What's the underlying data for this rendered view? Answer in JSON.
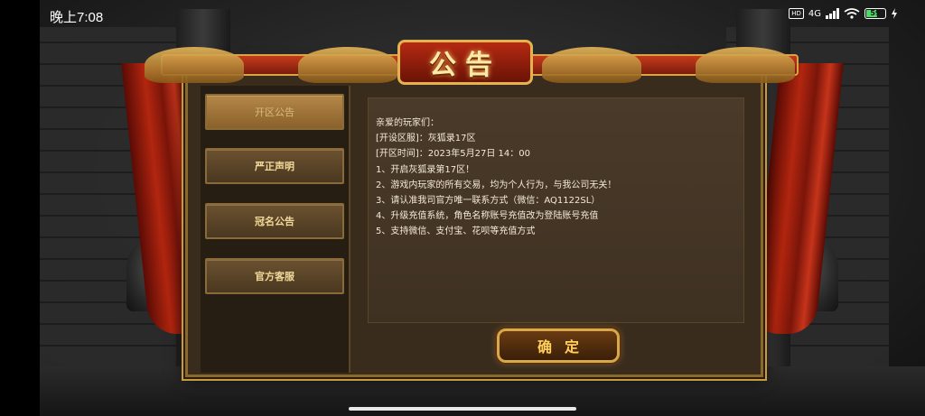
{
  "status_bar": {
    "time": "晚上7:08",
    "hd": "HD",
    "network": "4G",
    "battery": "59"
  },
  "dialog": {
    "title": "公告",
    "menu": [
      {
        "label": "开区公告",
        "active": true
      },
      {
        "label": "严正声明",
        "active": false
      },
      {
        "label": "冠名公告",
        "active": false
      },
      {
        "label": "官方客服",
        "active": false
      }
    ],
    "content_lines": [
      "亲爱的玩家们：",
      "[开设区服]：灰狐录17区",
      "[开区时间]：2023年5月27日 14：00",
      "1、开启灰狐录第17区！",
      "2、游戏内玩家的所有交易，均为个人行为，与我公司无关！",
      "3、请认准我司官方唯一联系方式（微信：AQ1122SL）",
      "4、升级充值系统，角色名称账号充值改为登陆账号充值",
      "5、支持微信、支付宝、花呗等充值方式"
    ],
    "confirm_label": "确定"
  },
  "colors": {
    "accent_gold": "#d8a84a",
    "title_red": "#b52a12",
    "text": "#f4ead6"
  }
}
